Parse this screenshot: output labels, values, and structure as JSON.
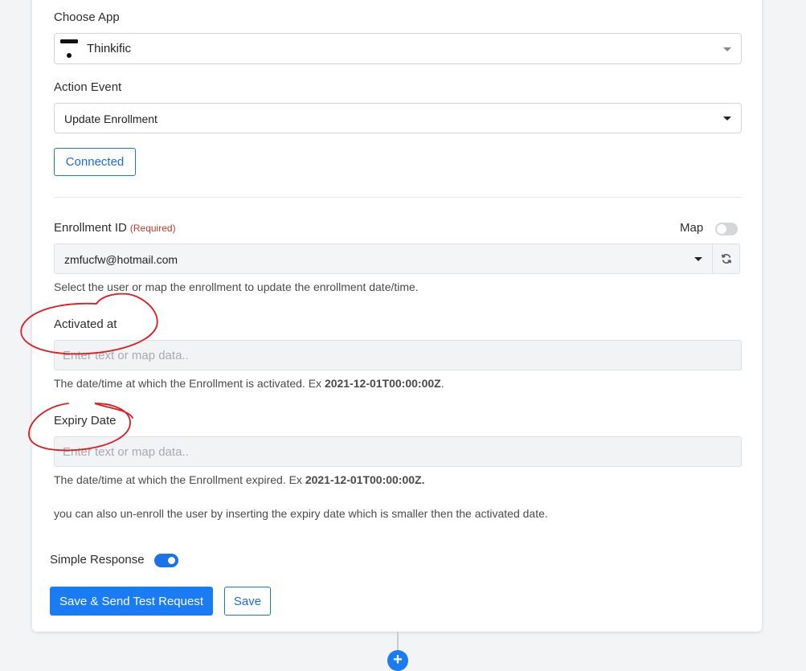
{
  "choose_app": {
    "label": "Choose App",
    "selected": "Thinkific",
    "icon": "thinkific-logo-icon"
  },
  "action_event": {
    "label": "Action Event",
    "selected": "Update Enrollment"
  },
  "connection": {
    "button_label": "Connected"
  },
  "enrollment_id": {
    "label": "Enrollment ID",
    "required": "(Required)",
    "map_label": "Map",
    "value": "zmfucfw@hotmail.com",
    "help": "Select the user or map the enrollment to update the enrollment date/time."
  },
  "activated_at": {
    "label": "Activated at",
    "placeholder": "Enter text or map data..",
    "help_prefix": "The date/time at which the Enrollment is activated. Ex ",
    "help_example": "2021-12-01T00:00:00Z",
    "help_suffix": "."
  },
  "expiry_date": {
    "label": "Expiry Date",
    "placeholder": "Enter text or map data..",
    "help_prefix": "The date/time at which the Enrollment expired. Ex ",
    "help_example": "2021-12-01T00:00:00Z.",
    "note": "you can also un-enroll the user by inserting the expiry date which is smaller then the activated date."
  },
  "simple_response": {
    "label": "Simple Response",
    "enabled": true
  },
  "actions": {
    "save_send_label": "Save & Send Test Request",
    "save_label": "Save"
  },
  "colors": {
    "accent": "#1a7cf5",
    "required": "#c0392b",
    "annotation": "#e0191e"
  }
}
